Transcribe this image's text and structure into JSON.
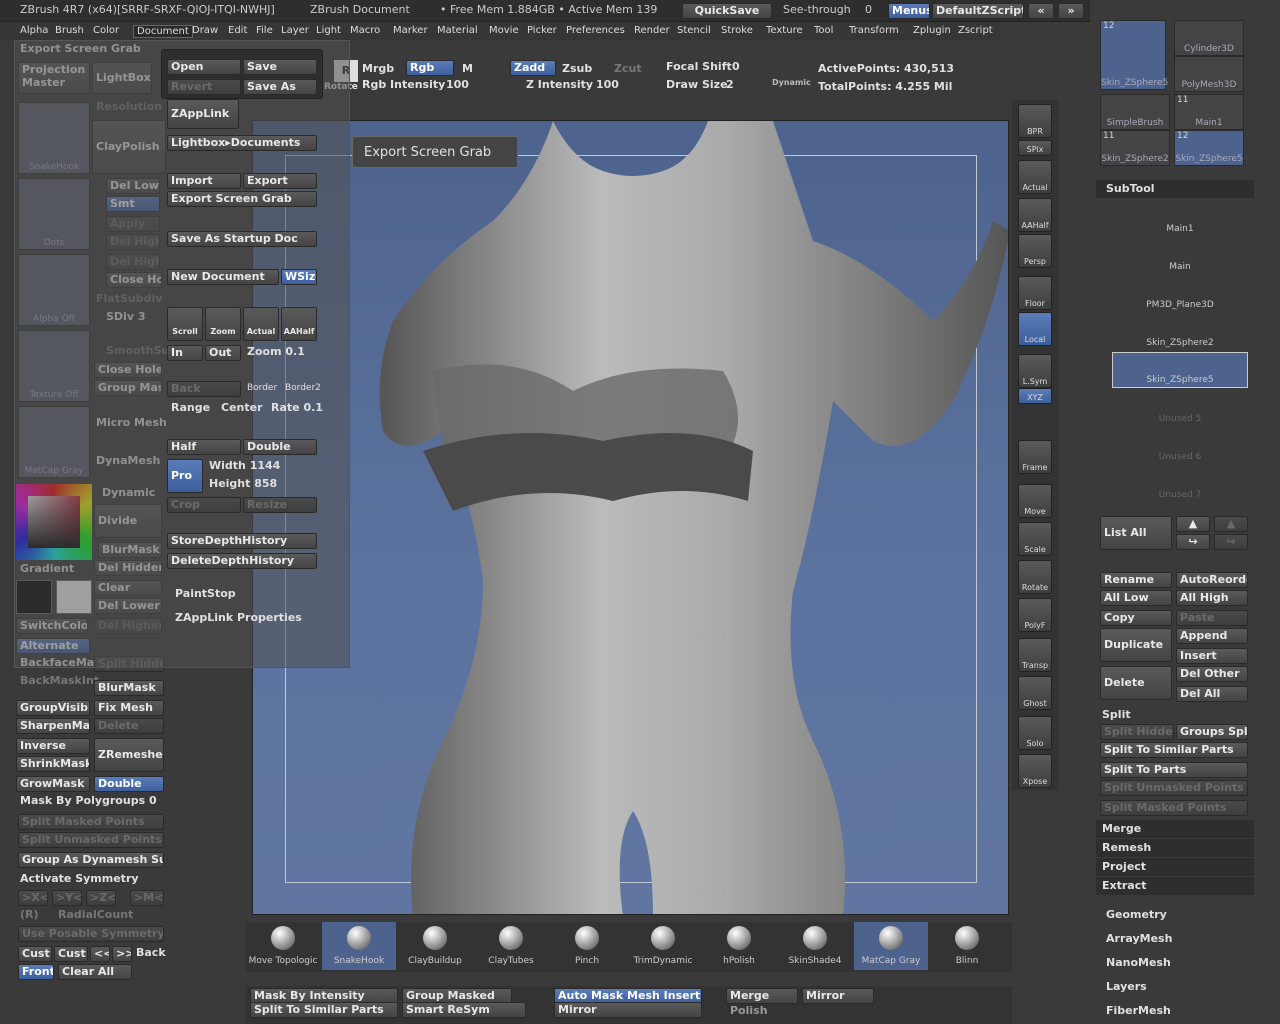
{
  "titlebar": {
    "app": "ZBrush 4R7 (x64)[SRRF-SRXF-QIOJ-ITQI-NWHJ]",
    "doc": "ZBrush Document",
    "mem": "• Free Mem 1.884GB • Active Mem 139",
    "quicksave": "QuickSave",
    "seethrough": "See-through",
    "seethrough_val": "0",
    "menus": "Menus",
    "script": "DefaultZScript"
  },
  "menubar": [
    "Alpha",
    "Brush",
    "Color",
    "Document",
    "Draw",
    "Edit",
    "File",
    "Layer",
    "Light",
    "Macro",
    "Marker",
    "Material",
    "Movie",
    "Picker",
    "Preferences",
    "Render",
    "Stencil",
    "Stroke",
    "Texture",
    "Tool",
    "Transform",
    "Zplugin",
    "Zscript"
  ],
  "topbar": {
    "rotate": "Rotate",
    "mrgb": "Mrgb",
    "rgb": "Rgb",
    "m": "M",
    "zadd": "Zadd",
    "zsub": "Zsub",
    "zcut": "Zcut",
    "focal_shift": "Focal Shift",
    "focal_shift_val": "0",
    "rgb_intensity": "Rgb Intensity",
    "rgb_intensity_val": "100",
    "z_intensity": "Z Intensity",
    "z_intensity_val": "100",
    "draw_size": "Draw Size",
    "draw_size_val": "2",
    "dynamic": "Dynamic",
    "active_points": "ActivePoints: 430,513",
    "total_points": "TotalPoints: 4.255 Mil"
  },
  "tooltip": "Export Screen Grab",
  "leftpanel": {
    "header": "Export Screen Grab",
    "projection_master": "Projection Master",
    "lightbox": "LightBox",
    "resolution": "Resolution",
    "claypolish": "ClayPolish",
    "snakehook": "SnakeHook",
    "dots": "Dots",
    "alpha_off": "Alpha Off",
    "texture_off": "Texture Off",
    "matcap_gray": "MatCap Gray",
    "del_lower": "Del Lower",
    "smt": "Smt",
    "apply": "Apply",
    "del_higher": "Del Higher",
    "close_holes_a": "Close Hol",
    "flatsubdiv": "FlatSubdiv",
    "sdiv": "SDiv 3",
    "smoothsub": "SmoothSubdiv",
    "close_holes": "Close Holes",
    "group_masked": "Group Masked",
    "micro_mesh": "Micro Mesh",
    "dynamesh": "DynaMesh",
    "dynamic": "Dynamic",
    "divide": "Divide",
    "blurmask": "BlurMask",
    "del_hidden": "Del Hidden",
    "clear": "Clear",
    "del_lower2": "Del Lower",
    "del_higher2": "Del Higher",
    "gradient": "Gradient",
    "switchcolor": "SwitchColor",
    "alternate": "Alternate",
    "backfacemask": "BackfaceMask",
    "backmaskint": "BackMaskInt",
    "blurmask2": "BlurMask",
    "split_hidden": "Split Hidden",
    "groupvisible": "GroupVisible",
    "fix_mesh": "Fix Mesh",
    "sharpenmask": "SharpenMask",
    "delete": "Delete",
    "inverse": "Inverse",
    "zremesher": "ZRemesher",
    "shrinkmask": "ShrinkMask",
    "growmask": "GrowMask",
    "double": "Double",
    "mask_by_polygroups": "Mask By Polygroups 0",
    "split_masked_points": "Split Masked Points",
    "split_unmasked_points": "Split Unmasked Points",
    "group_as_dynamesh": "Group As Dynamesh Sub",
    "activate_symmetry": "Activate Symmetry",
    "sx": ">X<",
    "sy": ">Y<",
    "sz": ">Z<",
    "sm": ">M<",
    "r": "(R)",
    "radialcount": "RadialCount",
    "use_posable": "Use Posable Symmetry",
    "cust1": "Cust",
    "cust2": "Cust",
    "prev": "<<",
    "next": ">>",
    "back": "Back",
    "front": "Front",
    "clear_all": "Clear All"
  },
  "docpanel": {
    "open": "Open",
    "save": "Save",
    "revert": "Revert",
    "save_as": "Save As",
    "zapplink": "ZAppLink",
    "lightbox_docs": "Lightbox▸Documents",
    "import": "Import",
    "export": "Export",
    "export_screen_grab": "Export Screen Grab",
    "save_as_startup": "Save As Startup Doc",
    "new_document": "New Document",
    "wsize": "WSize",
    "scroll": "Scroll",
    "zoom": "Zoom",
    "actual": "Actual",
    "aahalf": "AAHalf",
    "in": "In",
    "out": "Out",
    "zoom_val": "Zoom 0.1",
    "back": "Back",
    "border": "Border",
    "border2": "Border2",
    "range": "Range",
    "center": "Center",
    "rate": "Rate 0.1",
    "half": "Half",
    "double": "Double",
    "pro": "Pro",
    "width": "Width 1144",
    "height": "Height 858",
    "crop": "Crop",
    "resize": "Resize",
    "store_depth": "StoreDepthHistory",
    "delete_depth": "DeleteDepthHistory",
    "paintstop": "PaintStop",
    "zapplink_props": "ZAppLink Properties"
  },
  "rightstrip": [
    "BPR",
    "SPix",
    "Actual",
    "AAHalf",
    "Persp",
    "Floor",
    "Local",
    "L.Sym",
    "XYZ",
    "Frame",
    "Move",
    "Scale",
    "Rotate",
    "PolyF",
    "Transp",
    "Ghost",
    "Solo",
    "Xpose"
  ],
  "toolpanel": {
    "thumbs": [
      {
        "name": "Skin_ZSphere5",
        "count": "12"
      },
      {
        "name": "Cylinder3D",
        "count": ""
      },
      {
        "name": "PolyMesh3D",
        "count": ""
      },
      {
        "name": "SimpleBrush",
        "count": ""
      },
      {
        "name": "Main1",
        "count": "11"
      },
      {
        "name": "Skin_ZSphere2",
        "count": "11"
      },
      {
        "name": "Skin_ZSphere5",
        "count": "12"
      }
    ],
    "subtool_header": "SubTool",
    "subtools": [
      "Main1",
      "Main",
      "PM3D_Plane3D",
      "Skin_ZSphere2",
      "Skin_ZSphere5",
      "Unused 5",
      "Unused 6",
      "Unused 7"
    ],
    "list_all": "List All",
    "rename": "Rename",
    "autoreorder": "AutoReorder",
    "all_low": "All Low",
    "all_high": "All High",
    "copy": "Copy",
    "paste": "Paste",
    "duplicate": "Duplicate",
    "append": "Append",
    "insert": "Insert",
    "delete": "Delete",
    "del_other": "Del Other",
    "del_all": "Del All",
    "split": "Split",
    "split_hidden": "Split Hidden",
    "groups_split": "Groups Split",
    "split_similar": "Split To Similar Parts",
    "split_parts": "Split To Parts",
    "split_unmasked": "Split Unmasked Points",
    "split_masked": "Split Masked Points",
    "merge": "Merge",
    "remesh": "Remesh",
    "project": "Project",
    "extract": "Extract",
    "geometry": "Geometry",
    "arraymesh": "ArrayMesh",
    "nanomesh": "NanoMesh",
    "layers": "Layers",
    "fibermesh": "FiberMesh"
  },
  "brushes": [
    "Move Topologic",
    "SnakeHook",
    "ClayBuildup",
    "ClayTubes",
    "Pinch",
    "TrimDynamic",
    "hPolish",
    "SkinShade4",
    "MatCap Gray",
    "Blinn"
  ],
  "bottombar": {
    "mask_by_intensity": "Mask By Intensity",
    "group_masked": "Group Masked",
    "auto_mask": "Auto Mask Mesh Insert",
    "merge": "Merge",
    "mirror": "Mirror",
    "split_similar": "Split To Similar Parts",
    "smart_resym": "Smart ReSym",
    "mirror2": "Mirror",
    "polish": "Polish"
  }
}
